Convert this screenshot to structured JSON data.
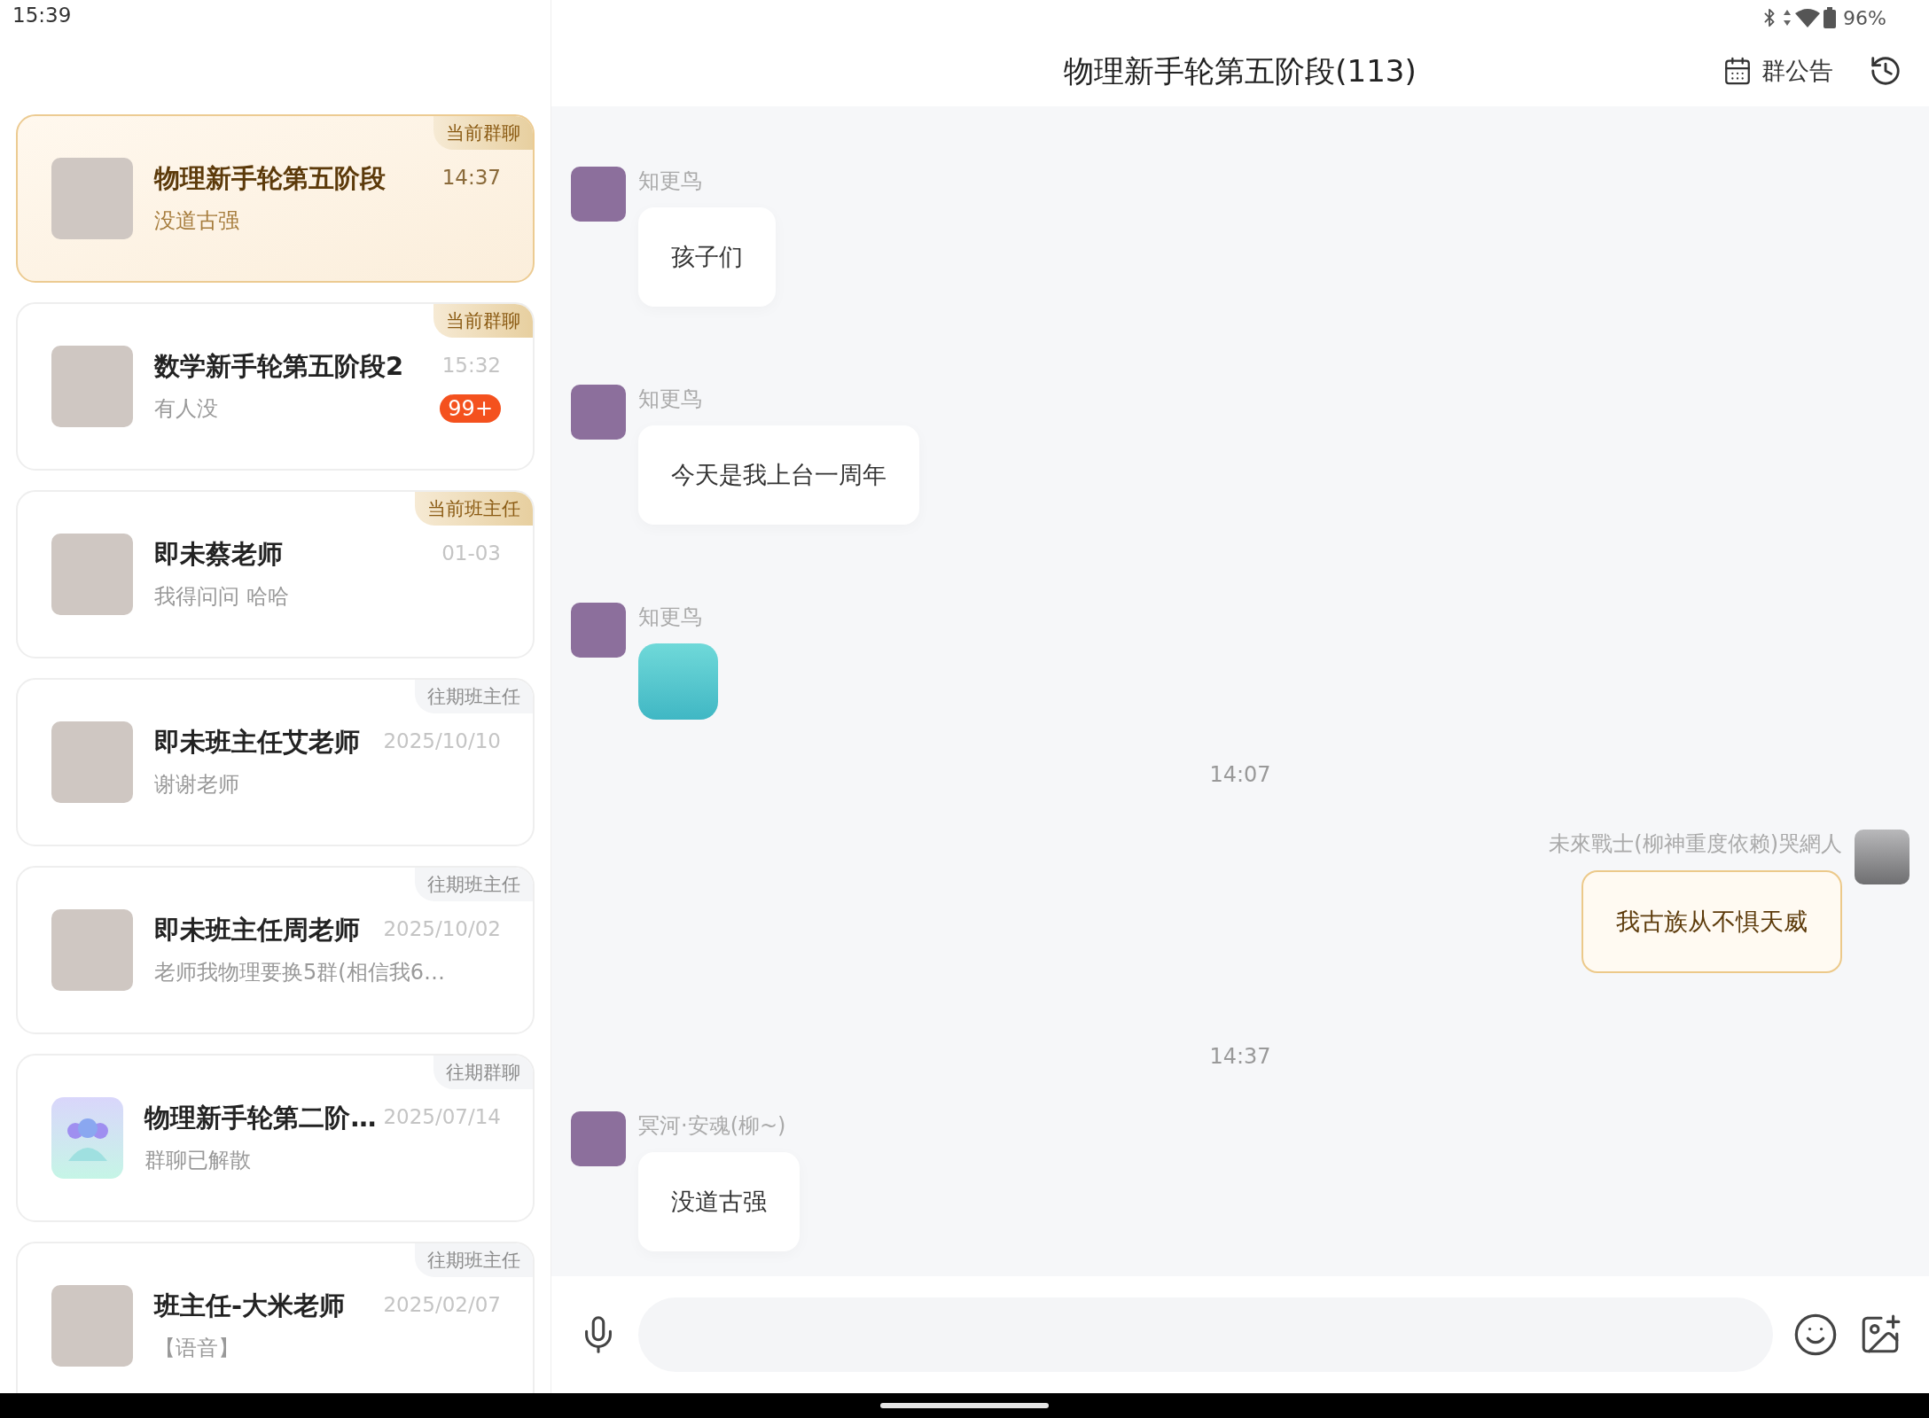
{
  "status_bar": {
    "time": "15:39",
    "battery": "96%"
  },
  "conversations": [
    {
      "kind": "photo",
      "title": "物理新手轮第五阶段",
      "preview": "没道古强",
      "time": "14:37",
      "tag": {
        "text": "当前群聊",
        "current": true
      },
      "selected": true
    },
    {
      "kind": "photo",
      "title": "数学新手轮第五阶段2",
      "preview": "有人没",
      "time": "15:32",
      "tag": {
        "text": "当前群聊",
        "current": true
      },
      "selected": false,
      "badge": "99+"
    },
    {
      "kind": "photo",
      "title": "即未蔡老师",
      "preview": "我得问问  哈哈",
      "time": "01-03",
      "tag": {
        "text": "当前班主任",
        "current": true
      },
      "selected": false
    },
    {
      "kind": "photo",
      "title": "即未班主任艾老师",
      "preview": "谢谢老师",
      "time": "2025/10/10",
      "tag": {
        "text": "往期班主任",
        "current": false
      },
      "selected": false
    },
    {
      "kind": "photo",
      "title": "即未班主任周老师",
      "preview": "老师我物理要换5群(相信我6…",
      "time": "2025/10/02",
      "tag": {
        "text": "往期班主任",
        "current": false
      },
      "selected": false
    },
    {
      "kind": "group",
      "title": "物理新手轮第二阶…",
      "preview": "群聊已解散",
      "time": "2025/07/14",
      "tag": {
        "text": "往期群聊",
        "current": false
      },
      "selected": false
    },
    {
      "kind": "photo",
      "title": "班主任-大米老师",
      "preview": "【语音】",
      "time": "2025/02/07",
      "tag": {
        "text": "往期班主任",
        "current": false
      },
      "selected": false
    }
  ],
  "chat": {
    "title": "物理新手轮第五阶段(113)",
    "announcement_label": "群公告",
    "messages": [
      {
        "kind": "text",
        "mine": false,
        "sender": "知更鸟",
        "text": "孩子们"
      },
      {
        "kind": "text",
        "mine": false,
        "sender": "知更鸟",
        "text": "今天是我上台一周年"
      },
      {
        "kind": "sticker",
        "mine": false,
        "sender": "知更鸟"
      },
      {
        "kind": "time",
        "text": "14:07"
      },
      {
        "kind": "text",
        "mine": true,
        "sender": "未來戰士(柳神重度依赖)哭網人",
        "text": "我古族从不惧天威"
      },
      {
        "kind": "time",
        "text": "14:37"
      },
      {
        "kind": "text",
        "mine": false,
        "sender": "冥河·安魂(柳~)",
        "text": "没道古强"
      }
    ]
  }
}
